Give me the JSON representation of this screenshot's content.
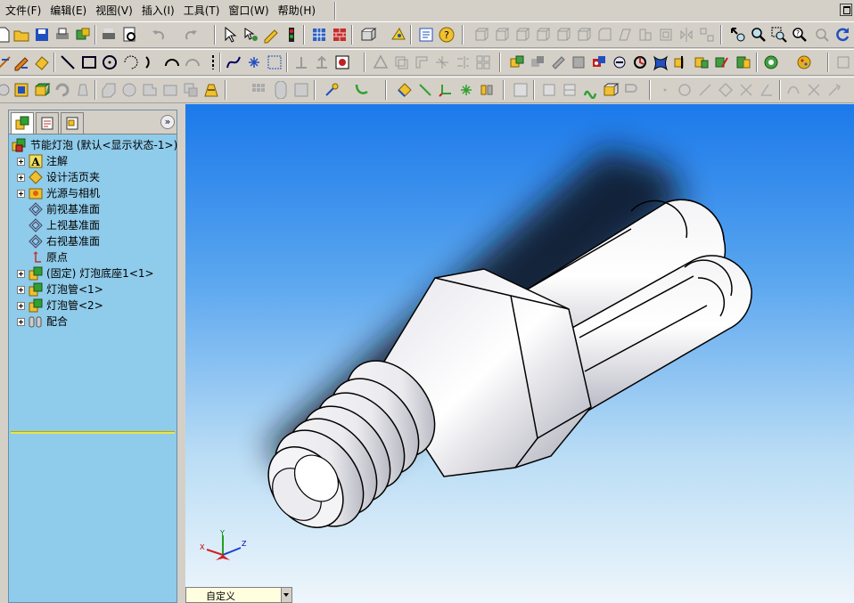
{
  "menu": {
    "items": [
      "文件(F)",
      "编辑(E)",
      "视图(V)",
      "插入(I)",
      "工具(T)",
      "窗口(W)",
      "帮助(H)"
    ]
  },
  "feature_tree": {
    "root": "节能灯泡   (默认<显示状态-1>)",
    "items": [
      "注解",
      "设计活页夹",
      "光源与相机",
      "前视基准面",
      "上视基准面",
      "右视基准面",
      "原点",
      "(固定) 灯泡底座1<1>",
      "灯泡管<1>",
      "灯泡管<2>",
      "配合"
    ]
  },
  "viewport": {
    "view_orientation": "自定义",
    "triad": {
      "x": "X",
      "y": "Y",
      "z": "Z"
    }
  },
  "colors": {
    "viewport_top": "#1b79ea",
    "viewport_bottom": "#eef6fb",
    "tree_background": "#8fcbea",
    "rollback_bar": "#e9e34a"
  }
}
